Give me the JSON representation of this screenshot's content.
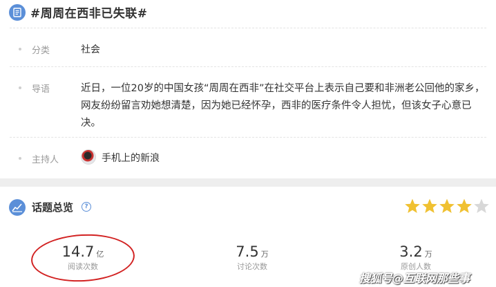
{
  "topic": {
    "title": "#周周在西非已失联#",
    "icon": "document-icon"
  },
  "category": {
    "label": "分类",
    "value": "社会"
  },
  "intro": {
    "label": "导语",
    "text": "近日，一位20岁的中国女孩“周周在西非”在社交平台上表示自己要和非洲老公回他的家乡，网友纷纷留言劝她想清楚，因为她已经怀孕，西非的医疗条件令人担忧，但该女子心意已决。"
  },
  "host": {
    "label": "主持人",
    "name": "手机上的新浪"
  },
  "overview": {
    "title": "话题总览",
    "help": "?",
    "rating": 4,
    "rating_max": 5,
    "stats": [
      {
        "number": "14.7",
        "unit": "亿",
        "label": "阅读次数"
      },
      {
        "number": "7.5",
        "unit": "万",
        "label": "讨论次数"
      },
      {
        "number": "3.2",
        "unit": "万",
        "label": "原创人数"
      }
    ]
  },
  "watermark": "搜狐号@互联网那些事",
  "colors": {
    "accent": "#5b8fd8",
    "star": "#f0c132",
    "star_empty": "#d8d8d8",
    "annotation": "#d22222"
  }
}
